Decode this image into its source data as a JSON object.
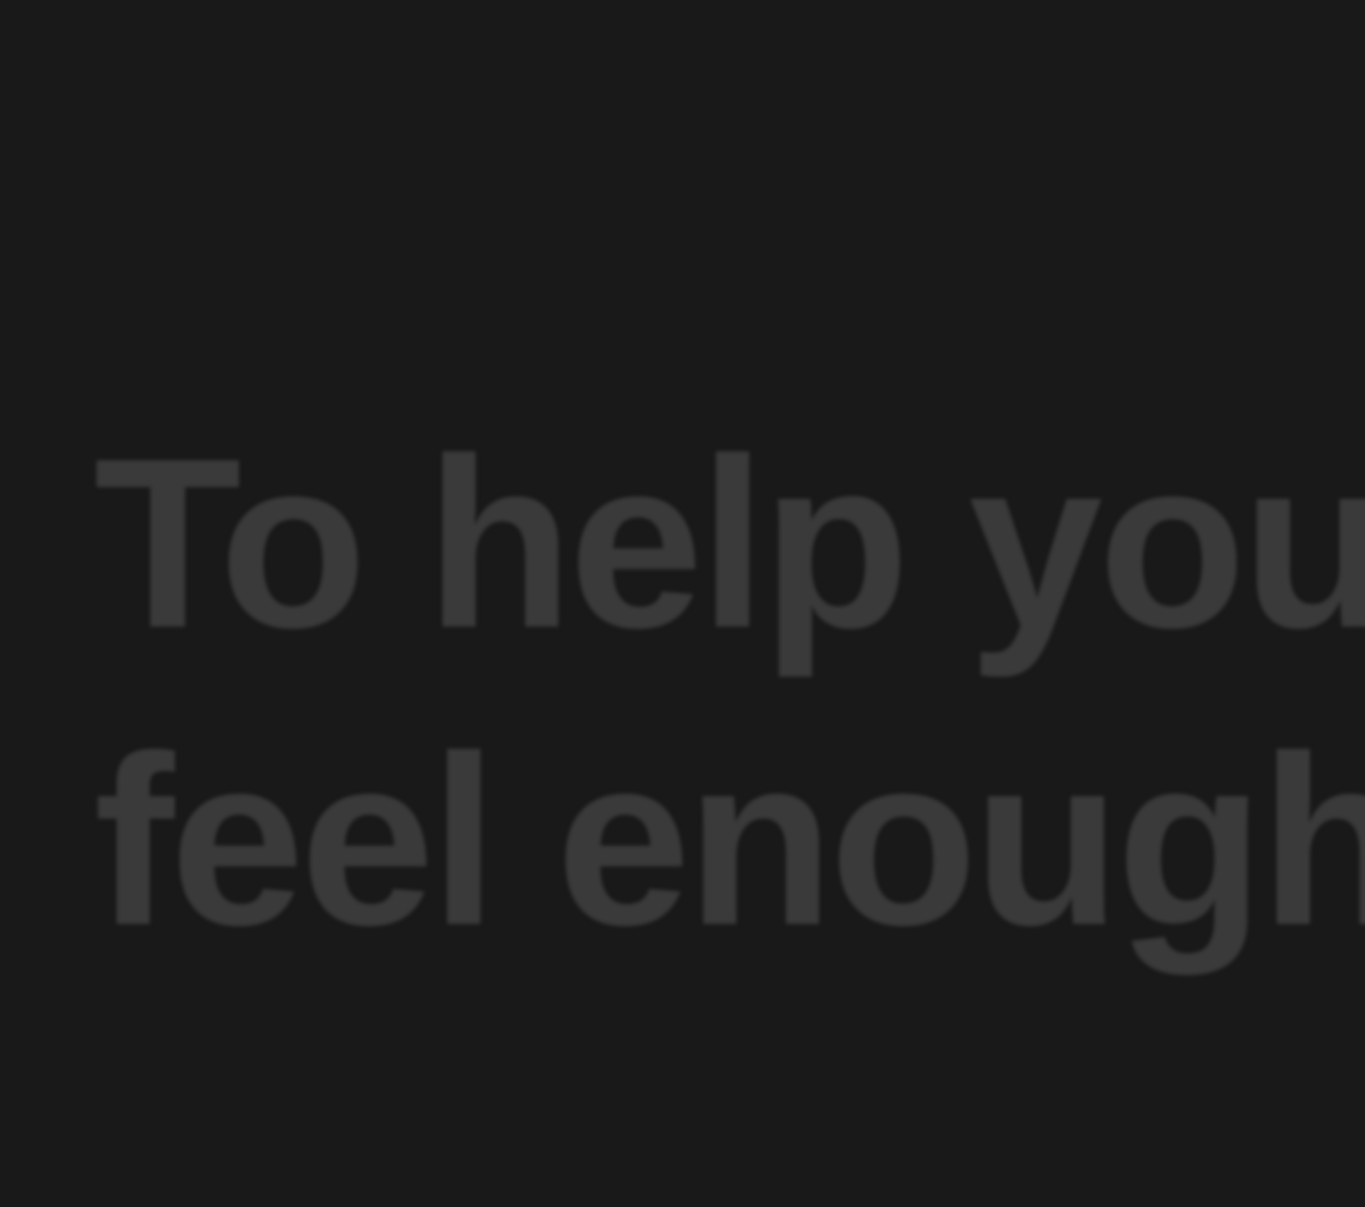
{
  "theme": {
    "background": "#1a191a",
    "text_color": "#3a3a3a"
  },
  "headline": {
    "line1": "To help you",
    "line2": "feel enough"
  }
}
